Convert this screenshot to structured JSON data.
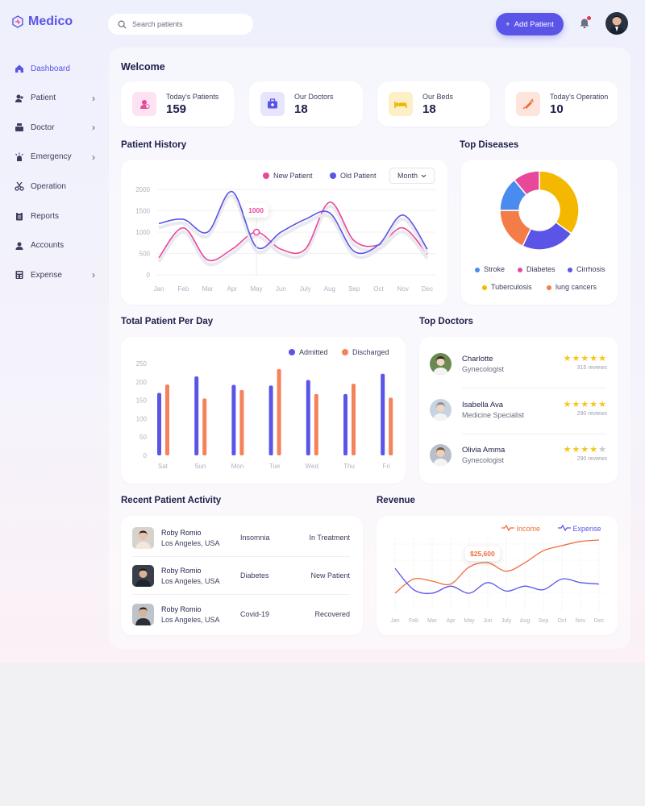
{
  "app": {
    "name": "Medico"
  },
  "header": {
    "search_placeholder": "Search patients",
    "add_button": "Add Patient"
  },
  "sidebar": {
    "items": [
      {
        "label": "Dashboard",
        "icon": "home-icon",
        "active": true,
        "chevron": false
      },
      {
        "label": "Patient",
        "icon": "patient-icon",
        "chevron": true
      },
      {
        "label": "Doctor",
        "icon": "doctor-icon",
        "chevron": true
      },
      {
        "label": "Emergency",
        "icon": "emergency-icon",
        "chevron": true
      },
      {
        "label": "Operation",
        "icon": "scissors-icon",
        "chevron": false
      },
      {
        "label": "Reports",
        "icon": "clipboard-icon",
        "chevron": false
      },
      {
        "label": "Accounts",
        "icon": "user-icon",
        "chevron": false
      },
      {
        "label": "Expense",
        "icon": "calculator-icon",
        "chevron": true
      }
    ]
  },
  "welcome": "Welcome",
  "stats": [
    {
      "label": "Today's Patients",
      "value": "159",
      "icon": "patient-badge-icon",
      "bg": "#fde3f1",
      "color": "#e8489a"
    },
    {
      "label": "Our Doctors",
      "value": "18",
      "icon": "medical-kit-icon",
      "bg": "#e6e5fb",
      "color": "#5b55e7"
    },
    {
      "label": "Our Beds",
      "value": "18",
      "icon": "bed-icon",
      "bg": "#fdf0c7",
      "color": "#f0b400"
    },
    {
      "label": "Today's Operation",
      "value": "10",
      "icon": "syringe-icon",
      "bg": "#fde5dd",
      "color": "#ef6c3f"
    }
  ],
  "patient_history": {
    "title": "Patient History",
    "legend": [
      "New Patient",
      "Old Patient"
    ],
    "dropdown": "Month",
    "tooltip": "1000",
    "colors": {
      "new": "#e8489a",
      "old": "#5b55e7"
    }
  },
  "top_diseases": {
    "title": "Top Diseases",
    "legend": [
      {
        "label": "Stroke",
        "color": "#4a8bef"
      },
      {
        "label": "Diabetes",
        "color": "#e8489a"
      },
      {
        "label": "Cirrhosis",
        "color": "#5b55e7"
      },
      {
        "label": "Tuberculosis",
        "color": "#f5b800"
      },
      {
        "label": "lung cancers",
        "color": "#f47c48"
      }
    ]
  },
  "patients_per_day": {
    "title": "Total Patient Per Day",
    "legend": [
      "Admitted",
      "Discharged"
    ],
    "colors": {
      "admitted": "#5b55e7",
      "discharged": "#f4825a"
    }
  },
  "top_doctors": {
    "title": "Top Doctors",
    "items": [
      {
        "name": "Charlotte",
        "specialty": "Gynecologist",
        "reviews": "315 reviews",
        "stars": 5
      },
      {
        "name": "Isabella Ava",
        "specialty": "Medicine Specialist",
        "reviews": "290 reviews",
        "stars": 5
      },
      {
        "name": "Olivia Amma",
        "specialty": "Gynecologist",
        "reviews": "290 reviews",
        "stars": 4
      }
    ]
  },
  "recent_activity": {
    "title": "Recent Patient Activity",
    "items": [
      {
        "name": "Roby Romio",
        "location": "Los Angeles, USA",
        "disease": "Insomnia",
        "status": "In Treatment"
      },
      {
        "name": "Roby Romio",
        "location": "Los Angeles, USA",
        "disease": "Diabetes",
        "status": "New Patient"
      },
      {
        "name": "Roby Romio",
        "location": "Los Angeles, USA",
        "disease": "Covid-19",
        "status": "Recovered"
      }
    ]
  },
  "revenue": {
    "title": "Revenue",
    "legend": [
      "Income",
      "Expense"
    ],
    "tooltip": "$25,600",
    "colors": {
      "income": "#ef6c3f",
      "expense": "#5b55e7"
    }
  },
  "chart_data": [
    {
      "id": "patient-history",
      "type": "line",
      "x": [
        "Jan",
        "Feb",
        "Mar",
        "Apr",
        "May",
        "Jun",
        "July",
        "Aug",
        "Sep",
        "Oct",
        "Nov",
        "Dec"
      ],
      "ylim": [
        0,
        2000
      ],
      "yticks": [
        0,
        500,
        1000,
        1500,
        2000
      ],
      "series": [
        {
          "name": "New Patient",
          "values": [
            400,
            1100,
            350,
            600,
            1000,
            600,
            600,
            1700,
            800,
            700,
            1100,
            480
          ]
        },
        {
          "name": "Old Patient",
          "values": [
            1200,
            1300,
            1000,
            1950,
            650,
            1000,
            1300,
            1450,
            550,
            700,
            1400,
            600
          ]
        }
      ]
    },
    {
      "id": "top-diseases",
      "type": "pie",
      "categories": [
        "Tuberculosis",
        "Cirrhosis",
        "lung cancers",
        "Stroke",
        "Diabetes"
      ],
      "values": [
        35,
        22,
        18,
        14,
        11
      ]
    },
    {
      "id": "patients-per-day",
      "type": "bar",
      "categories": [
        "Sat",
        "Sun",
        "Mon",
        "Tue",
        "Wed",
        "Thu",
        "Fri"
      ],
      "ylim": [
        0,
        250
      ],
      "yticks": [
        0,
        50,
        100,
        150,
        200,
        250
      ],
      "series": [
        {
          "name": "Admitted",
          "values": [
            170,
            215,
            192,
            190,
            205,
            167,
            222
          ]
        },
        {
          "name": "Discharged",
          "values": [
            193,
            155,
            178,
            235,
            167,
            195,
            157
          ]
        }
      ]
    },
    {
      "id": "revenue",
      "type": "line",
      "x": [
        "Jan",
        "Feb",
        "Mar",
        "Apr",
        "May",
        "Jun",
        "July",
        "Aug",
        "Sep",
        "Oct",
        "Nov",
        "Dec"
      ],
      "series": [
        {
          "name": "Income",
          "values": [
            25,
            45,
            42,
            38,
            62,
            68,
            56,
            68,
            85,
            92,
            98,
            100
          ]
        },
        {
          "name": "Expense",
          "values": [
            60,
            30,
            25,
            35,
            25,
            40,
            28,
            35,
            30,
            45,
            40,
            38
          ]
        }
      ]
    }
  ]
}
